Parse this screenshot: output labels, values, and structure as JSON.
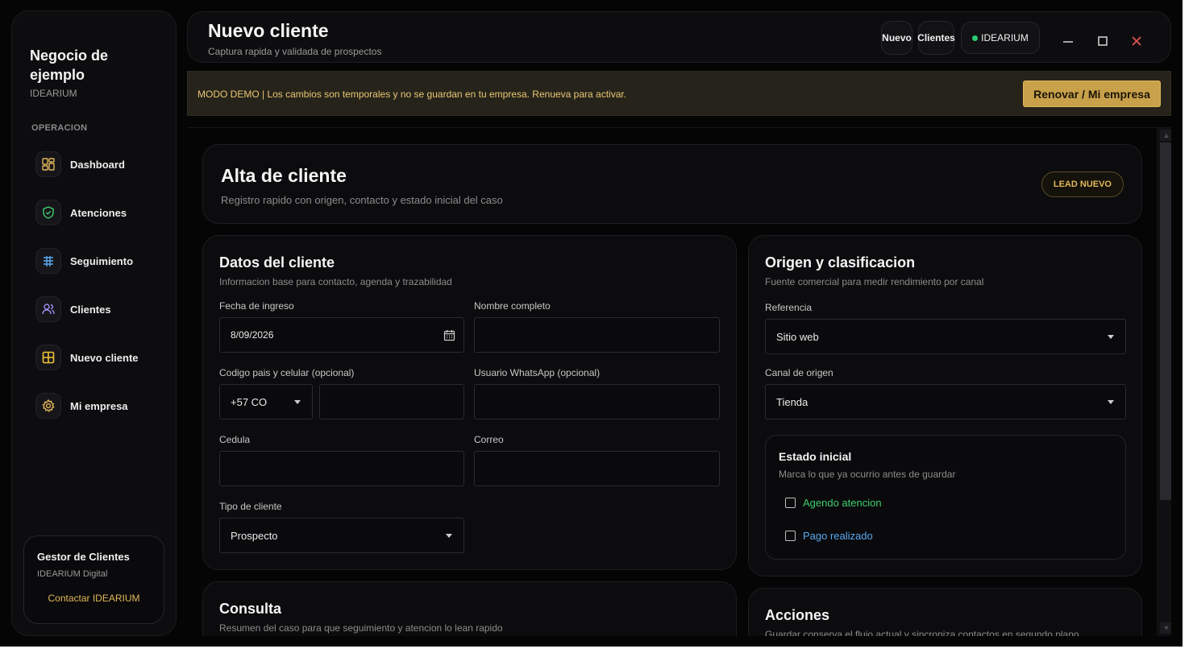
{
  "sidebar": {
    "brand_title": "Negocio de ejemplo",
    "brand_sub": "IDEARIUM",
    "section_label": "OPERACION",
    "items": [
      {
        "label": "Dashboard",
        "icon": "dashboard-icon"
      },
      {
        "label": "Atenciones",
        "icon": "shield-check-icon"
      },
      {
        "label": "Seguimiento",
        "icon": "table-grid-icon"
      },
      {
        "label": "Clientes",
        "icon": "users-icon"
      },
      {
        "label": "Nuevo cliente",
        "icon": "grid-plus-icon"
      },
      {
        "label": "Mi empresa",
        "icon": "gear-icon"
      }
    ],
    "footer": {
      "title": "Gestor de Clientes",
      "subtitle": "IDEARIUM Digital",
      "link": "Contactar IDEARIUM"
    }
  },
  "header": {
    "title": "Nuevo cliente",
    "subtitle": "Captura rapida y validada de prospectos",
    "btn_nuevo": "Nuevo",
    "btn_clientes": "Clientes",
    "status_label": "IDEARIUM",
    "status_color": "#2ecc71"
  },
  "banner": {
    "text": "MODO DEMO | Los cambios son temporales y no se guardan en tu empresa. Renueva para activar.",
    "button": "Renovar / Mi empresa"
  },
  "alta": {
    "title": "Alta de cliente",
    "subtitle": "Registro rapido con origen, contacto y estado inicial del caso",
    "badge": "LEAD NUEVO"
  },
  "datos": {
    "title": "Datos del cliente",
    "subtitle": "Informacion base para contacto, agenda y trazabilidad",
    "fecha_label": "Fecha de ingreso",
    "fecha_value": "8/09/2026",
    "nombre_label": "Nombre completo",
    "nombre_value": "",
    "telefono_label": "Codigo pais y celular (opcional)",
    "codigo_value": "+57 CO",
    "celular_value": "",
    "whatsapp_label": "Usuario WhatsApp (opcional)",
    "whatsapp_value": "",
    "cedula_label": "Cedula",
    "cedula_value": "",
    "correo_label": "Correo",
    "correo_value": "",
    "tipo_label": "Tipo de cliente",
    "tipo_value": "Prospecto"
  },
  "origen": {
    "title": "Origen y clasificacion",
    "subtitle": "Fuente comercial para medir rendimiento por canal",
    "referencia_label": "Referencia",
    "referencia_value": "Sitio web",
    "canal_label": "Canal de origen",
    "canal_value": "Tienda",
    "estado": {
      "title": "Estado inicial",
      "subtitle": "Marca lo que ya ocurrio antes de guardar",
      "agendo_label": "Agendo atencion",
      "agendo_color": "#3ecf6e",
      "pago_label": "Pago realizado",
      "pago_color": "#5aa9f0"
    }
  },
  "consulta": {
    "title": "Consulta",
    "subtitle": "Resumen del caso para que seguimiento y atencion lo lean rapido"
  },
  "acciones": {
    "title": "Acciones",
    "subtitle": "Guardar conserva el flujo actual y sincroniza contactos en segundo plano"
  },
  "colors": {
    "accent_gold": "#c9a14a",
    "background": "#050505"
  }
}
